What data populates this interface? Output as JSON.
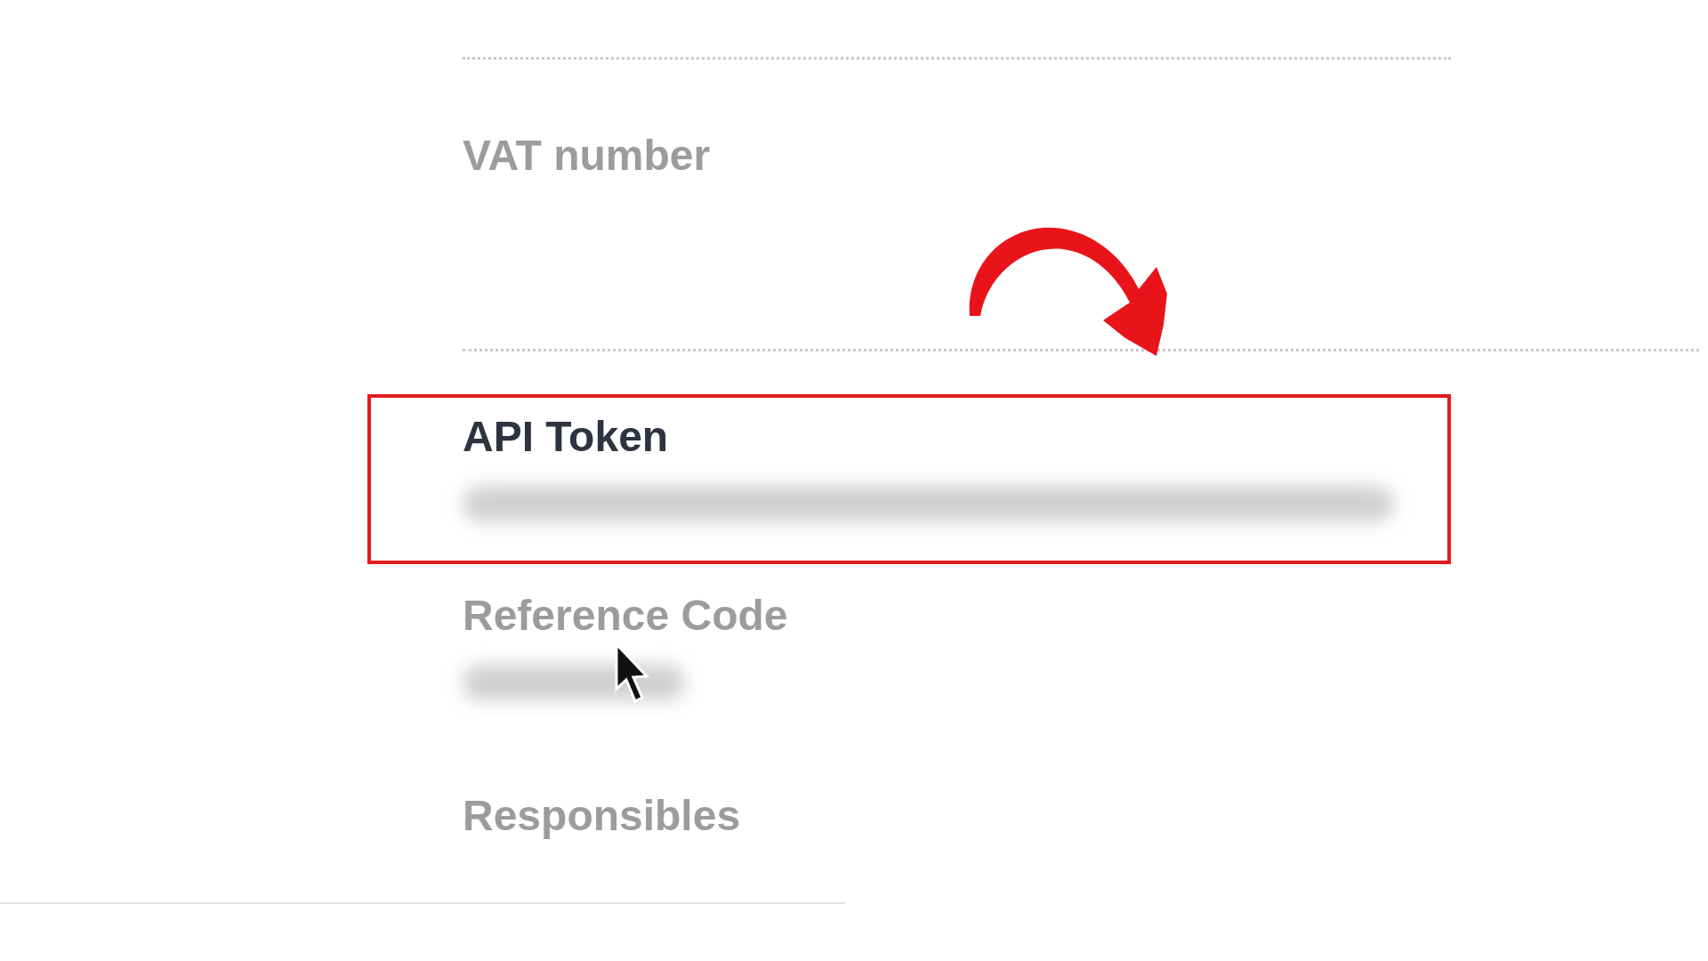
{
  "fields": [
    {
      "label": "VAT number",
      "emphasized": false,
      "value_redacted": false,
      "highlighted": false
    },
    {
      "label": "API Token",
      "emphasized": true,
      "value_redacted": true,
      "highlighted": true
    },
    {
      "label": "Reference Code",
      "emphasized": false,
      "value_redacted": true,
      "highlighted": false
    },
    {
      "label": "Responsibles",
      "emphasized": false,
      "value_redacted": false,
      "highlighted": false
    }
  ]
}
